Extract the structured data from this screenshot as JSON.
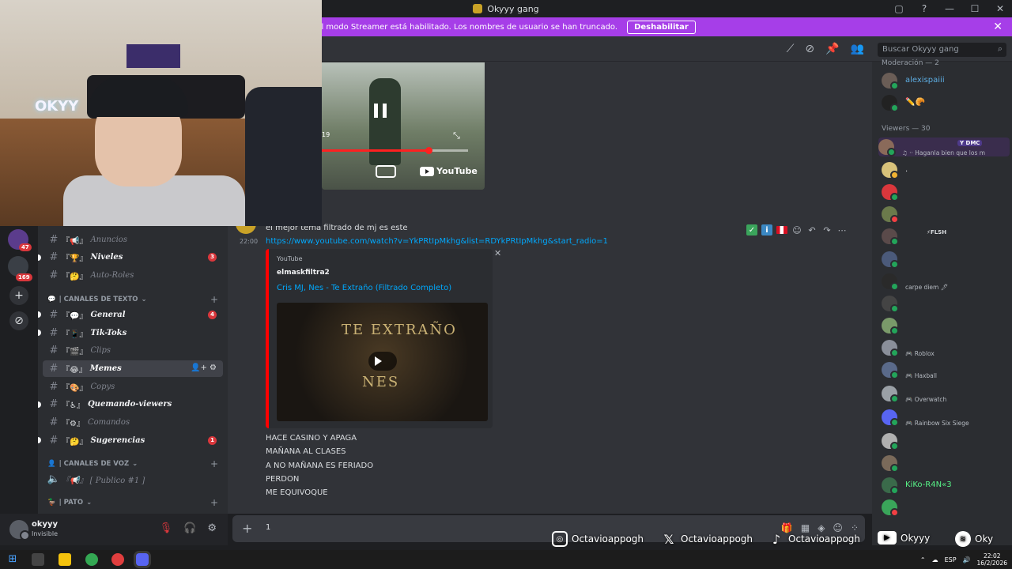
{
  "window": {
    "title": "Okyyy gang",
    "controls": [
      "▢",
      "?",
      "—",
      "☐",
      "✕"
    ]
  },
  "banner": {
    "text": "El modo Streamer está habilitado. Los nombres de usuario se han truncado.",
    "button": "Deshabilitar",
    "close": "✕"
  },
  "search": {
    "placeholder": "Buscar Okyyy gang",
    "icon": "⌕"
  },
  "header_icons": [
    "⟋",
    "⊘",
    "📌",
    "👥"
  ],
  "video_embed_top": {
    "brand": "YouTube",
    "counter": "19",
    "progress_fraction": 0.73
  },
  "messages": {
    "top_text": "el mejor tema filtrado de mj es este",
    "time": "22:00",
    "link": "https://www.youtube.com/watch?v=YkPRtIpMkhg&list=RDYkPRtIpMkhg&start_radio=1",
    "embed": {
      "provider": "YouTube",
      "author": "elmaskfiltra2",
      "title": "Cris MJ, Nes - Te Extraño (Filtrado Completo)",
      "thumb_line1": "TE EXTRAÑO",
      "thumb_line2": "NES"
    },
    "lines": [
      "HACE CASINO Y APAGA",
      "MAÑANA AL CLASES",
      "A NO MAÑANA ES FERIADO",
      "PERDON",
      "ME EQUIVOQUE"
    ],
    "hover_actions": [
      "✓",
      "i",
      "",
      "☺",
      "↶",
      "↷",
      "⋯"
    ]
  },
  "composer": {
    "plus": "+",
    "typed": "1",
    "tools": [
      "🎁",
      "▦",
      "◈",
      "☺",
      "⁘"
    ]
  },
  "rail": {
    "badges": [
      "47",
      "169"
    ],
    "add": "+",
    "explore": "⊘"
  },
  "channels": {
    "items": [
      {
        "emoji": "📢",
        "name": "Anuncios",
        "state": "muted",
        "badge": ""
      },
      {
        "emoji": "🏆",
        "name": "Niveles",
        "state": "unread",
        "badge": "3"
      },
      {
        "emoji": "🤔",
        "name": "Auto-Roles",
        "state": "muted",
        "badge": ""
      },
      {
        "emoji": "💬",
        "name": "General",
        "state": "unread",
        "badge": "4"
      },
      {
        "emoji": "📱",
        "name": "Tik-Toks",
        "state": "unread",
        "badge": ""
      },
      {
        "emoji": "🎬",
        "name": "Clips",
        "state": "muted",
        "badge": ""
      },
      {
        "emoji": "😂",
        "name": "Memes",
        "state": "active",
        "badge": ""
      },
      {
        "emoji": "🎨",
        "name": "Copys",
        "state": "muted",
        "badge": ""
      },
      {
        "emoji": "♿",
        "name": "Quemando-viewers",
        "state": "unread",
        "badge": ""
      },
      {
        "emoji": "⚙",
        "name": "Comandos",
        "state": "muted",
        "badge": ""
      },
      {
        "emoji": "🤔",
        "name": "Sugerencias",
        "state": "unread",
        "badge": "1"
      }
    ],
    "bracket": "『",
    "cat_text": "| CANALES DE TEXTO",
    "cat_voice": "| CANALES DE VOZ",
    "voice_channel": "『📢』 [ Publico #1 ]",
    "cat_pato": "| PATO",
    "active_actions": "👤+ ⚙"
  },
  "user": {
    "name": "okyyy",
    "status": "Invisible"
  },
  "members": {
    "group_mod": "Moderación — 2",
    "group_viewers": "Viewers — 30",
    "list": [
      {
        "name": "alexispaiii",
        "color": "#5dade2",
        "activity": "",
        "tag": "",
        "status": "#23a55a"
      },
      {
        "name": "✏️🥐",
        "color": "#e03e3e",
        "activity": "",
        "tag": "",
        "status": "#23a55a"
      },
      {
        "name": "",
        "color": "#e03e3e",
        "activity": "♫ ·· Haganla bien que los m",
        "tag": "Y DMC",
        "status": "#23a55a"
      },
      {
        "name": ".",
        "color": "#dbdee1",
        "activity": "",
        "tag": "",
        "status": "#f0b232"
      },
      {
        "name": "",
        "color": "#e03e3e",
        "activity": "",
        "tag": "",
        "status": "#23a55a"
      },
      {
        "name": "",
        "color": "#e03e3e",
        "activity": "",
        "tag": "",
        "status": "#f23f43"
      },
      {
        "name": "",
        "color": "#e03e3e",
        "activity": "",
        "tag": "⚡FLSH",
        "status": "#23a55a"
      },
      {
        "name": "",
        "color": "#e03e3e",
        "activity": "",
        "tag": "",
        "status": "#23a55a"
      },
      {
        "name": "",
        "color": "#e03e3e",
        "activity": "carpe diem 🖊",
        "tag": "",
        "status": "#23a55a"
      },
      {
        "name": "",
        "color": "#e03e3e",
        "activity": "",
        "tag": "",
        "status": "#23a55a"
      },
      {
        "name": "",
        "color": "#e03e3e",
        "activity": "",
        "tag": "",
        "status": "#23a55a"
      },
      {
        "name": "",
        "color": "#e03e3e",
        "activity": "🎮 Roblox",
        "tag": "",
        "status": "#23a55a"
      },
      {
        "name": "",
        "color": "#e03e3e",
        "activity": "🎮 Haxball",
        "tag": "",
        "status": "#23a55a"
      },
      {
        "name": "",
        "color": "#e03e3e",
        "activity": "🎮 Overwatch",
        "tag": "",
        "status": "#23a55a"
      },
      {
        "name": "",
        "color": "#e03e3e",
        "activity": "🎮 Rainbow Six Siege",
        "tag": "",
        "status": "#23a55a"
      },
      {
        "name": "",
        "color": "#e03e3e",
        "activity": "",
        "tag": "",
        "status": "#23a55a"
      },
      {
        "name": "",
        "color": "#e03e3e",
        "activity": "",
        "tag": "",
        "status": "#23a55a"
      },
      {
        "name": "KiKo-R4N«3",
        "color": "#57f287",
        "activity": "",
        "tag": "",
        "status": "#23a55a"
      },
      {
        "name": "",
        "color": "#e03e3e",
        "activity": "",
        "tag": "",
        "status": "#f23f43"
      }
    ]
  },
  "social": {
    "instagram": "Octavioappogh",
    "x": "Octavioappogh",
    "tiktok": "Octavioappogh",
    "youtube": "Okyyy",
    "spotify": "Oky"
  },
  "taskbar": {
    "lang": "ESP",
    "time": "22:02",
    "date": "16/2/2026",
    "tray_icons": [
      "⌃",
      "☁",
      "🔊"
    ]
  },
  "webcam": {
    "neon": "OKYY"
  }
}
